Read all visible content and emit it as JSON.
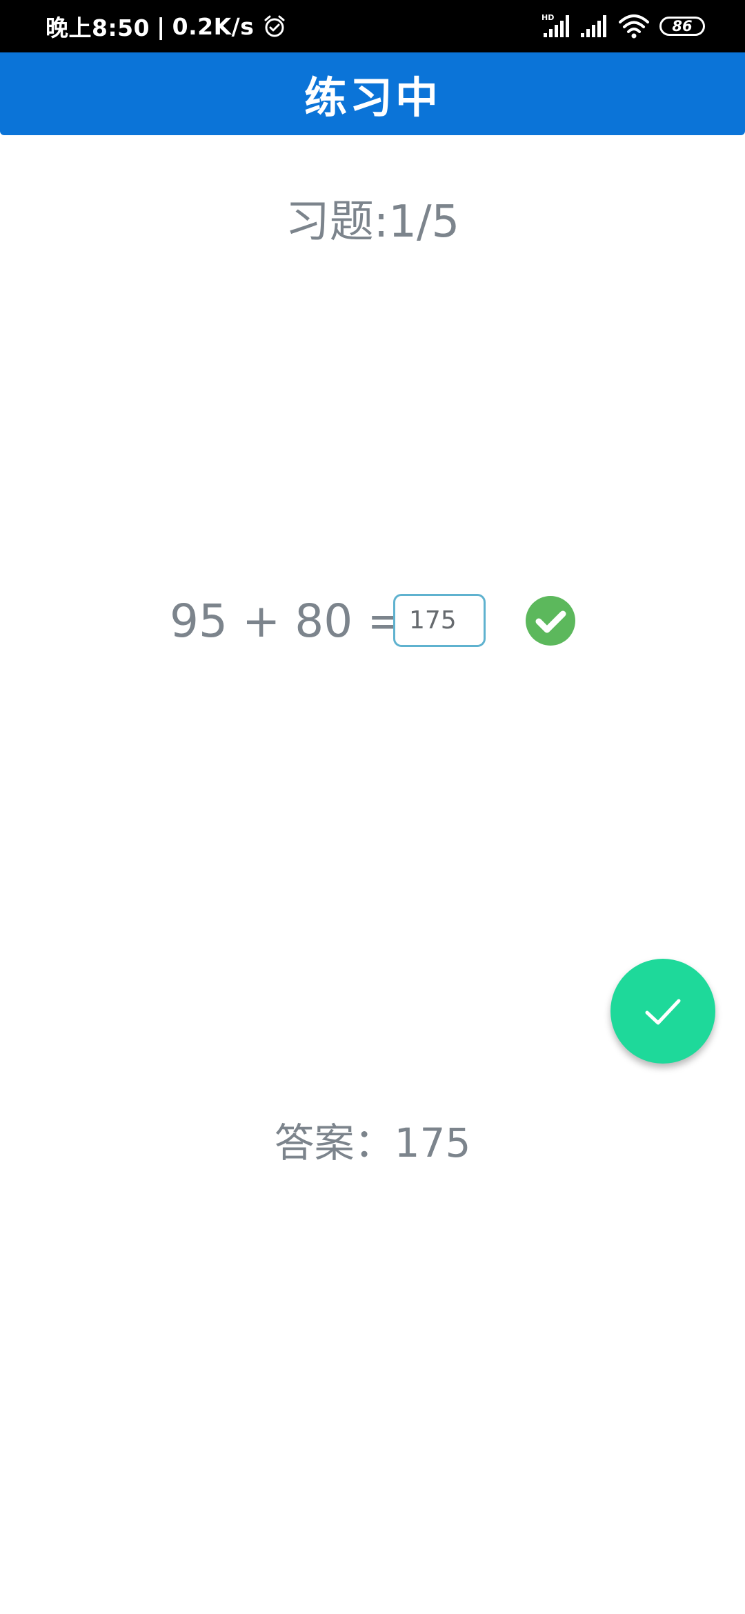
{
  "status_bar": {
    "time": "晚上8:50",
    "separator": "|",
    "speed": "0.2K/s",
    "hd_label": "HD",
    "battery": "86",
    "icons": [
      "alarm-icon",
      "hd-signal-icon",
      "signal-icon",
      "wifi-icon",
      "battery-icon"
    ]
  },
  "app_bar": {
    "title": "练习中",
    "color": "#0b74d8"
  },
  "quiz": {
    "progress": "习题:1/5",
    "equation": "95 + 80 =",
    "input_value": "175",
    "result_icon": "check-circle-icon",
    "result_color": "#5cb85c",
    "answer_label": "答案：175"
  },
  "fab": {
    "icon": "check-icon",
    "color": "#1ed99a"
  }
}
